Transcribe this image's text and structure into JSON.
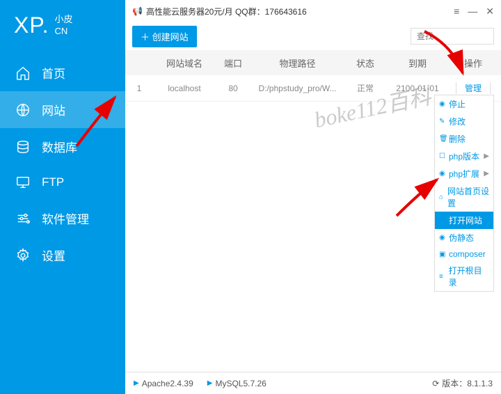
{
  "logo": {
    "main": "XP.",
    "sub1": "小皮",
    "sub2": "CN"
  },
  "sidebar": {
    "items": [
      {
        "label": "首页"
      },
      {
        "label": "网站"
      },
      {
        "label": "数据库"
      },
      {
        "label": "FTP"
      },
      {
        "label": "软件管理"
      },
      {
        "label": "设置"
      }
    ]
  },
  "titlebar": {
    "text": "高性能云服务器20元/月  QQ群：176643616"
  },
  "toolbar": {
    "create": "＋ 创建网站",
    "search_placeholder": "查找"
  },
  "table": {
    "headers": {
      "domain": "网站域名",
      "port": "端口",
      "path": "物理路径",
      "status": "状态",
      "expire": "到期",
      "action": "操作"
    },
    "rows": [
      {
        "idx": "1",
        "domain": "localhost",
        "port": "80",
        "path": "D:/phpstudy_pro/W...",
        "status": "正常",
        "expire": "2100-01-01",
        "action": "管理"
      }
    ]
  },
  "dropdown": {
    "items": [
      {
        "label": "停止",
        "icon": "◉"
      },
      {
        "label": "修改",
        "icon": "✎"
      },
      {
        "label": "删除",
        "icon": "🗑"
      },
      {
        "label": "php版本",
        "icon": "☐",
        "arrow": true
      },
      {
        "label": "php扩展",
        "icon": "◉",
        "arrow": true
      },
      {
        "label": "网站首页设置",
        "icon": "⌂"
      },
      {
        "label": "打开网站",
        "icon": "",
        "highlighted": true
      },
      {
        "label": "伪静态",
        "icon": "◉"
      },
      {
        "label": "composer",
        "icon": "▣"
      },
      {
        "label": "打开根目录",
        "icon": "≡"
      }
    ]
  },
  "watermark": "boke112百科",
  "footer": {
    "services": [
      {
        "label": "Apache2.4.39"
      },
      {
        "label": "MySQL5.7.26"
      }
    ],
    "version_label": "版本：",
    "version": "8.1.1.3"
  }
}
